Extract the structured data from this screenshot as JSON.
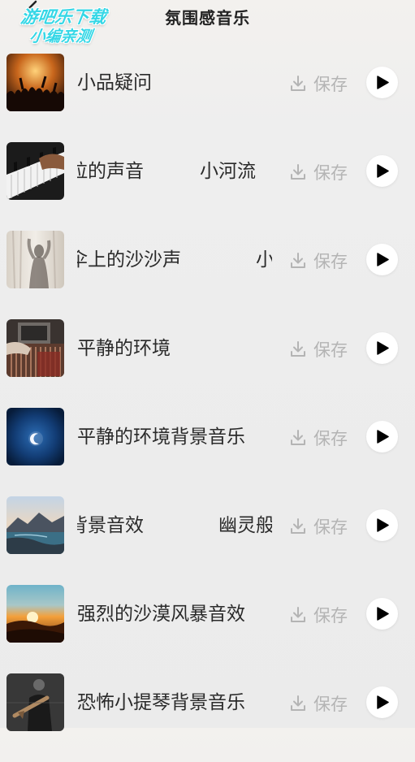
{
  "header": {
    "title": "氛围感音乐",
    "watermark_line1": "游吧乐下载",
    "watermark_line2": "小编亲测"
  },
  "icons": {
    "back": "back-arrow-icon",
    "download": "download-icon",
    "play": "play-icon"
  },
  "colors": {
    "save_text": "#b4b4b4",
    "watermark": "#35d7e6",
    "play_bg": "#ffffff"
  },
  "items": [
    {
      "title": "小品疑问",
      "thumb": "concert-crowd",
      "save_label": "保存"
    },
    {
      "title": "拉的声音　　　小河流",
      "thumb": "piano-keys",
      "save_label": "保存"
    },
    {
      "title": "伞上的沙沙声　　　　小",
      "thumb": "shadow-silhouette",
      "save_label": "保存"
    },
    {
      "title": "平静的环境",
      "thumb": "record-player",
      "save_label": "保存"
    },
    {
      "title": "平静的环境背景音乐",
      "thumb": "blue-moon",
      "save_label": "保存"
    },
    {
      "title": "背景音效　　　　幽灵般",
      "thumb": "mountain-lake",
      "save_label": "保存"
    },
    {
      "title": "强烈的沙漠风暴音效",
      "thumb": "desert-sunset",
      "save_label": "保存"
    },
    {
      "title": "恐怖小提琴背景音乐",
      "thumb": "violinist",
      "save_label": "保存"
    }
  ]
}
